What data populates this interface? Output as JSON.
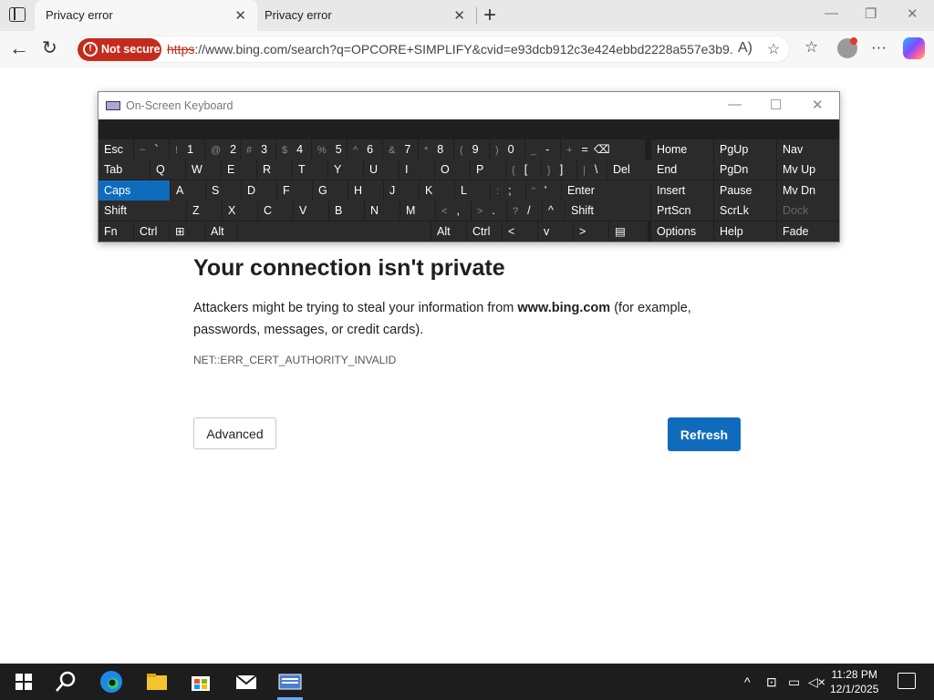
{
  "browser": {
    "tabs": [
      {
        "label": "Privacy error",
        "active": true
      },
      {
        "label": "Privacy error",
        "active": false
      }
    ],
    "security_badge": "Not secure",
    "url_scheme": "https",
    "url_rest": "://www.bing.com/search?q=OPCORE+SIMPLIFY&cvid=e93dcb912c3e424ebbd2228a557e3b9...",
    "accent_color": "#0f6cbd",
    "warning_color": "#c42b1c"
  },
  "page": {
    "title": "Your connection isn't private",
    "desc_before": "Attackers might be trying to steal your information from ",
    "desc_host": "www.bing.com",
    "desc_after": " (for example, passwords, messages, or credit cards).",
    "error_code": "NET::ERR_CERT_AUTHORITY_INVALID",
    "advanced_label": "Advanced",
    "refresh_label": "Refresh"
  },
  "osk": {
    "title": "On-Screen Keyboard",
    "rows": [
      [
        {
          "pri": "Esc"
        },
        {
          "sec": "~",
          "pri": "`"
        },
        {
          "sec": "!",
          "pri": "1"
        },
        {
          "sec": "@",
          "pri": "2"
        },
        {
          "sec": "#",
          "pri": "3"
        },
        {
          "sec": "$",
          "pri": "4"
        },
        {
          "sec": "%",
          "pri": "5"
        },
        {
          "sec": "^",
          "pri": "6"
        },
        {
          "sec": "&",
          "pri": "7"
        },
        {
          "sec": "*",
          "pri": "8"
        },
        {
          "sec": "(",
          "pri": "9"
        },
        {
          "sec": ")",
          "pri": "0"
        },
        {
          "sec": "_",
          "pri": "-"
        },
        {
          "sec": "+",
          "pri": "="
        },
        {
          "pri": "⌫"
        },
        {
          "pri": "Home"
        },
        {
          "pri": "PgUp"
        },
        {
          "pri": "Nav"
        }
      ],
      [
        {
          "pri": "Tab"
        },
        {
          "pri": "Q"
        },
        {
          "pri": "W"
        },
        {
          "pri": "E"
        },
        {
          "pri": "R"
        },
        {
          "pri": "T"
        },
        {
          "pri": "Y"
        },
        {
          "pri": "U"
        },
        {
          "pri": "I"
        },
        {
          "pri": "O"
        },
        {
          "pri": "P"
        },
        {
          "sec": "{",
          "pri": "["
        },
        {
          "sec": "}",
          "pri": "]"
        },
        {
          "sec": "|",
          "pri": "\\"
        },
        {
          "pri": "Del"
        },
        {
          "pri": "End"
        },
        {
          "pri": "PgDn"
        },
        {
          "pri": "Mv Up"
        }
      ],
      [
        {
          "pri": "Caps",
          "selected": true
        },
        {
          "pri": "A"
        },
        {
          "pri": "S"
        },
        {
          "pri": "D"
        },
        {
          "pri": "F"
        },
        {
          "pri": "G"
        },
        {
          "pri": "H"
        },
        {
          "pri": "J"
        },
        {
          "pri": "K"
        },
        {
          "pri": "L"
        },
        {
          "sec": ":",
          "pri": ";"
        },
        {
          "sec": "\"",
          "pri": "'"
        },
        {
          "pri": "Enter"
        },
        {
          "pri": "Insert"
        },
        {
          "pri": "Pause"
        },
        {
          "pri": "Mv Dn"
        }
      ],
      [
        {
          "pri": "Shift"
        },
        {
          "pri": "Z"
        },
        {
          "pri": "X"
        },
        {
          "pri": "C"
        },
        {
          "pri": "V"
        },
        {
          "pri": "B"
        },
        {
          "pri": "N"
        },
        {
          "pri": "M"
        },
        {
          "sec": "<",
          "pri": ","
        },
        {
          "sec": ">",
          "pri": "."
        },
        {
          "sec": "?",
          "pri": "/"
        },
        {
          "pri": "^"
        },
        {
          "pri": "Shift"
        },
        {
          "pri": "PrtScn"
        },
        {
          "pri": "ScrLk"
        },
        {
          "pri": "Dock",
          "dim": true
        }
      ],
      [
        {
          "pri": "Fn"
        },
        {
          "pri": "Ctrl"
        },
        {
          "pri": "⊞"
        },
        {
          "pri": "Alt"
        },
        {
          "pri": ""
        },
        {
          "pri": "Alt"
        },
        {
          "pri": "Ctrl"
        },
        {
          "pri": "<"
        },
        {
          "pri": "v"
        },
        {
          "pri": ">"
        },
        {
          "pri": "▤"
        },
        {
          "pri": "Options"
        },
        {
          "pri": "Help"
        },
        {
          "pri": "Fade"
        }
      ]
    ]
  },
  "taskbar": {
    "time": "11:28 PM",
    "date": "12/1/2025"
  }
}
